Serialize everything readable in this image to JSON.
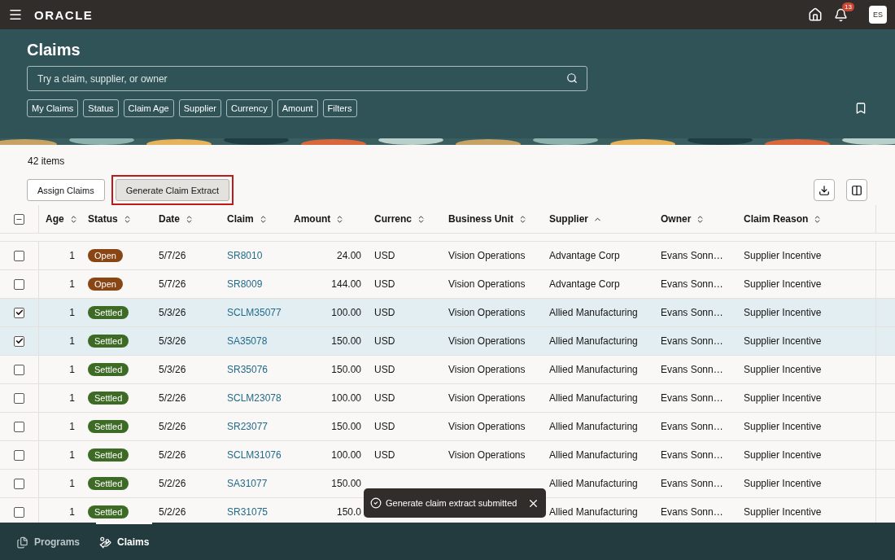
{
  "top_bar": {
    "logo": "ORACLE",
    "notification_count": "13",
    "avatar_initials": "ES"
  },
  "header": {
    "title": "Claims",
    "search": {
      "placeholder": "Try a claim, supplier, or owner"
    },
    "filters": [
      "My Claims",
      "Status",
      "Claim Age",
      "Supplier",
      "Currency",
      "Amount",
      "Filters"
    ]
  },
  "item_count": "42 items",
  "actions": [
    {
      "label": "Assign Claims",
      "highlighted": false
    },
    {
      "label": "Generate Claim Extract",
      "highlighted": true
    }
  ],
  "table": {
    "select_all": {
      "mixed": true
    },
    "columns": [
      {
        "label": "Age",
        "sorted": false
      },
      {
        "label": "Status",
        "sorted": false
      },
      {
        "label": "Date",
        "sorted": false
      },
      {
        "label": "Claim",
        "sorted": false
      },
      {
        "label": "Amount",
        "sorted": false
      },
      {
        "label": "Currenc",
        "sorted": false
      },
      {
        "label": "Business Unit",
        "sorted": false
      },
      {
        "label": "Supplier",
        "sorted": true
      },
      {
        "label": "Owner",
        "sorted": false
      },
      {
        "label": "Claim Reason",
        "sorted": false
      }
    ],
    "rows": [
      {
        "selected": false,
        "age": "1",
        "status": "Open",
        "color": "#8a4514",
        "date": "5/7/26",
        "claim": "SR8010",
        "amount": "24.00",
        "currency": "USD",
        "business_unit": "Vision Operations",
        "supplier": "Advantage Corp",
        "owner": "Evans Sonn…",
        "claim_reason": "Supplier Incentive"
      },
      {
        "selected": false,
        "age": "1",
        "status": "Open",
        "color": "#8a4514",
        "date": "5/7/26",
        "claim": "SR8009",
        "amount": "144.00",
        "currency": "USD",
        "business_unit": "Vision Operations",
        "supplier": "Advantage Corp",
        "owner": "Evans Sonn…",
        "claim_reason": "Supplier Incentive"
      },
      {
        "selected": true,
        "age": "1",
        "status": "Settled",
        "color": "#3d6b25",
        "date": "5/3/26",
        "claim": "SCLM35077",
        "amount": "100.00",
        "currency": "USD",
        "business_unit": "Vision Operations",
        "supplier": "Allied Manufacturing",
        "owner": "Evans Sonn…",
        "claim_reason": "Supplier Incentive"
      },
      {
        "selected": true,
        "age": "1",
        "status": "Settled",
        "color": "#3d6b25",
        "date": "5/3/26",
        "claim": "SA35078",
        "amount": "150.00",
        "currency": "USD",
        "business_unit": "Vision Operations",
        "supplier": "Allied Manufacturing",
        "owner": "Evans Sonn…",
        "claim_reason": "Supplier Incentive"
      },
      {
        "selected": false,
        "age": "1",
        "status": "Settled",
        "color": "#3d6b25",
        "date": "5/3/26",
        "claim": "SR35076",
        "amount": "150.00",
        "currency": "USD",
        "business_unit": "Vision Operations",
        "supplier": "Allied Manufacturing",
        "owner": "Evans Sonn…",
        "claim_reason": "Supplier Incentive"
      },
      {
        "selected": false,
        "age": "1",
        "status": "Settled",
        "color": "#3d6b25",
        "date": "5/2/26",
        "claim": "SCLM23078",
        "amount": "100.00",
        "currency": "USD",
        "business_unit": "Vision Operations",
        "supplier": "Allied Manufacturing",
        "owner": "Evans Sonn…",
        "claim_reason": "Supplier Incentive"
      },
      {
        "selected": false,
        "age": "1",
        "status": "Settled",
        "color": "#3d6b25",
        "date": "5/2/26",
        "claim": "SR23077",
        "amount": "150.00",
        "currency": "USD",
        "business_unit": "Vision Operations",
        "supplier": "Allied Manufacturing",
        "owner": "Evans Sonn…",
        "claim_reason": "Supplier Incentive"
      },
      {
        "selected": false,
        "age": "1",
        "status": "Settled",
        "color": "#3d6b25",
        "date": "5/2/26",
        "claim": "SCLM31076",
        "amount": "100.00",
        "currency": "USD",
        "business_unit": "Vision Operations",
        "supplier": "Allied Manufacturing",
        "owner": "Evans Sonn…",
        "claim_reason": "Supplier Incentive"
      },
      {
        "selected": false,
        "age": "1",
        "status": "Settled",
        "color": "#3d6b25",
        "date": "5/2/26",
        "claim": "SA31077",
        "amount": "150.00",
        "supplier": "Allied Manufacturing",
        "owner": "Evans Sonn…",
        "claim_reason": "Supplier Incentive"
      },
      {
        "selected": false,
        "age": "1",
        "status": "Settled",
        "color": "#3d6b25",
        "date": "5/2/26",
        "claim": "SR31075",
        "amount": "150.0",
        "supplier": "Allied Manufacturing",
        "owner": "Evans Sonn…",
        "claim_reason": "Supplier Incentive"
      }
    ]
  },
  "toast": {
    "message": "Generate claim extract submitted"
  },
  "bottom_nav": [
    {
      "label": "Programs",
      "selected": false
    },
    {
      "label": "Claims",
      "selected": true
    }
  ]
}
